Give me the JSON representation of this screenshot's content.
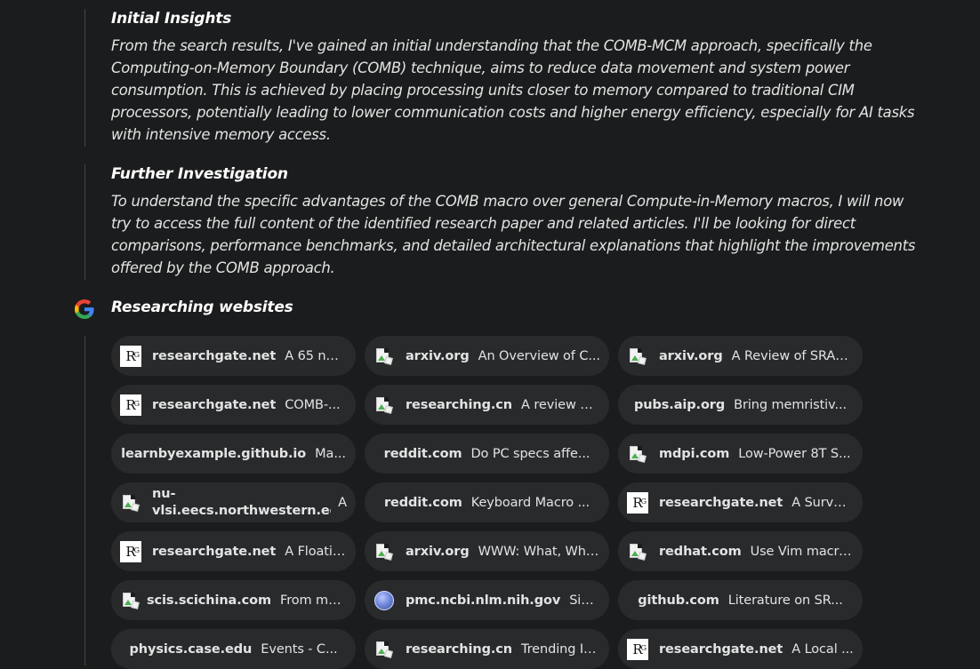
{
  "blocks": [
    {
      "title": "Initial Insights",
      "body": "From the search results, I've gained an initial understanding that the COMB-MCM approach, specifically the Computing-on-Memory Boundary (COMB) technique, aims to reduce data movement and system power consumption. This is achieved by placing processing units closer to memory compared to traditional CIM processors, potentially leading to lower communication costs and higher energy efficiency, especially for AI tasks with intensive memory access."
    },
    {
      "title": "Further Investigation",
      "body": "To understand the specific advantages of the COMB macro over general Compute-in-Memory macros, I will now try to access the full content of the identified research paper and related articles. I'll be looking for direct comparisons, performance benchmarks, and detailed architectural explanations that highlight the improvements offered by the COMB approach."
    }
  ],
  "researching": {
    "title": "Researching websites",
    "icon": "google-g-icon"
  },
  "sources": [
    {
      "site": "researchgate.net",
      "title": "A 65 nm ...",
      "icon": "researchgate"
    },
    {
      "site": "arxiv.org",
      "title": "An Overview of C...",
      "icon": "broken-image"
    },
    {
      "site": "arxiv.org",
      "title": "A Review of SRAM...",
      "icon": "broken-image"
    },
    {
      "site": "researchgate.net",
      "title": "COMB-...",
      "icon": "researchgate"
    },
    {
      "site": "researching.cn",
      "title": "A review on...",
      "icon": "broken-image"
    },
    {
      "site": "pubs.aip.org",
      "title": "Bring memristiv...",
      "icon": "none"
    },
    {
      "site": "learnbyexample.github.io",
      "title": "Ma...",
      "icon": "none"
    },
    {
      "site": "reddit.com",
      "title": "Do PC specs affe...",
      "icon": "none"
    },
    {
      "site": "mdpi.com",
      "title": "Low-Power 8T S...",
      "icon": "broken-image"
    },
    {
      "site": "nu-vlsi.eecs.northwestern.edu",
      "site_line1": "nu-",
      "site_line2": "vlsi.eecs.northwestern.edu",
      "title": "A",
      "icon": "broken-image"
    },
    {
      "site": "reddit.com",
      "title": "Keyboard Macro ...",
      "icon": "none"
    },
    {
      "site": "researchgate.net",
      "title": "A Survey...",
      "icon": "researchgate"
    },
    {
      "site": "researchgate.net",
      "title": "A Floatin...",
      "icon": "researchgate"
    },
    {
      "site": "arxiv.org",
      "title": "WWW: What, Whe...",
      "icon": "broken-image"
    },
    {
      "site": "redhat.com",
      "title": "Use Vim macro...",
      "icon": "broken-image"
    },
    {
      "site": "scis.scichina.com",
      "title": "From ma...",
      "icon": "broken-image"
    },
    {
      "site": "pmc.ncbi.nlm.nih.gov",
      "title": "Sim...",
      "icon": "globe"
    },
    {
      "site": "github.com",
      "title": "Literature on SR...",
      "icon": "none"
    },
    {
      "site": "physics.case.edu",
      "title": "Events - C...",
      "icon": "none"
    },
    {
      "site": "researching.cn",
      "title": "Trending IC ...",
      "icon": "broken-image"
    },
    {
      "site": "researchgate.net",
      "title": "A Local ...",
      "icon": "researchgate"
    }
  ],
  "researchgate_logo": {
    "letter": "R",
    "sup": "G"
  }
}
